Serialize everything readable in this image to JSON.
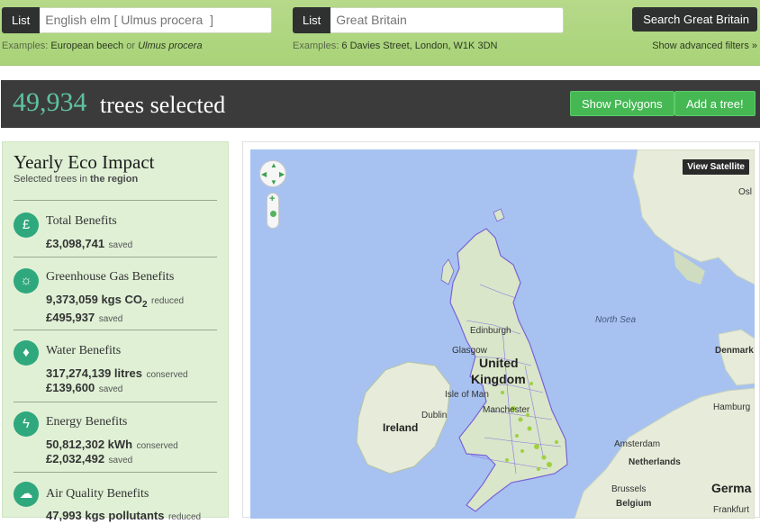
{
  "search": {
    "species_list_label": "List",
    "species_placeholder": "English elm [ Ulmus procera  ]",
    "species_examples_prefix": "Examples:",
    "species_example_1": "European beech",
    "species_example_or": "or",
    "species_example_2": "Ulmus procera",
    "location_list_label": "List",
    "location_placeholder": "Great Britain",
    "location_examples_prefix": "Examples:",
    "location_example": "6 Davies Street, London, W1K 3DN",
    "search_button": "Search Great Britain",
    "advanced_link": "Show advanced filters »"
  },
  "status": {
    "count": "49,934",
    "label": "trees selected",
    "polygons_button": "Show Polygons",
    "add_tree_button": "Add a tree!"
  },
  "impact": {
    "title": "Yearly Eco Impact",
    "subtitle_prefix": "Selected trees in",
    "subtitle_bold": "the region",
    "items": [
      {
        "icon": "pound-icon",
        "title": "Total Benefits",
        "lines": [
          {
            "value": "£3,098,741",
            "unit": "saved"
          }
        ]
      },
      {
        "icon": "sun-icon",
        "title": "Greenhouse Gas Benefits",
        "lines": [
          {
            "value": "9,373,059 kgs CO",
            "sub": "2",
            "unit": "reduced"
          },
          {
            "value": "£495,937",
            "unit": "saved"
          }
        ]
      },
      {
        "icon": "water-drop-icon",
        "title": "Water Benefits",
        "lines": [
          {
            "value": "317,274,139 litres",
            "unit": "conserved"
          },
          {
            "value": "£139,600",
            "unit": "saved"
          }
        ]
      },
      {
        "icon": "lightning-icon",
        "title": "Energy Benefits",
        "lines": [
          {
            "value": "50,812,302 kWh",
            "unit": "conserved"
          },
          {
            "value": "£2,032,492",
            "unit": "saved"
          }
        ]
      },
      {
        "icon": "cloud-icon",
        "title": "Air Quality Benefits",
        "lines": [
          {
            "value": "47,993 kgs pollutants",
            "unit": "reduced"
          }
        ]
      }
    ]
  },
  "map": {
    "view_satellite": "View Satellite",
    "labels": {
      "osl": "Osl",
      "north_sea": "North Sea",
      "edinburgh": "Edinburgh",
      "glasgow": "Glasgow",
      "united": "United",
      "kingdom": "Kingdom",
      "isle_of_man": "Isle of Man",
      "denmark": "Denmark",
      "dublin": "Dublin",
      "ireland": "Ireland",
      "manchester": "Manchester",
      "hamburg": "Hamburg",
      "amsterdam": "Amsterdam",
      "netherlands": "Netherlands",
      "brussels": "Brussels",
      "belgium": "Belgium",
      "germa": "Germa",
      "frankfurt": "Frankfurt"
    },
    "colors": {
      "sea": "#a7c2f0",
      "land": "#e6ecd9",
      "boundary": "#7a63d6",
      "trees": "#9ed040"
    }
  }
}
